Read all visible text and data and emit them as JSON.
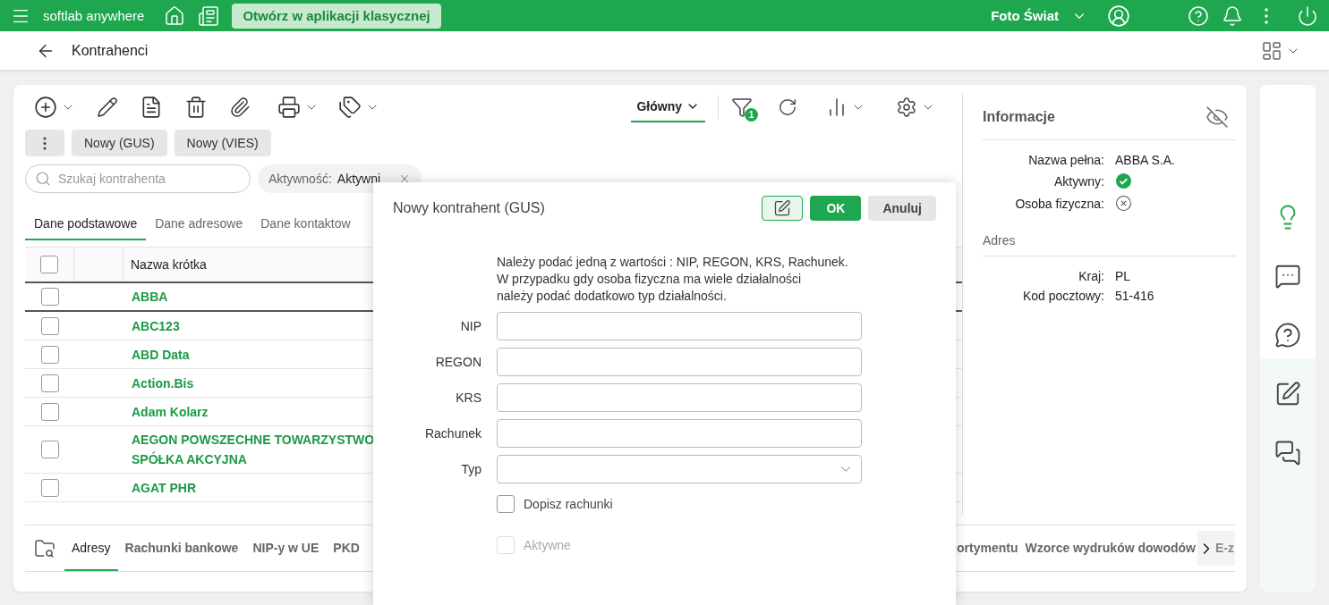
{
  "topbar": {
    "app_name": "softlab anywhere",
    "classic_button": "Otwórz w aplikacji klasycznej",
    "company": "Foto Świat"
  },
  "header": {
    "title": "Kontrahenci"
  },
  "toolbar": {
    "actions": [
      "Nowy (GUS)",
      "Nowy (VIES)"
    ],
    "view": "Główny",
    "filter_count": "1"
  },
  "search": {
    "placeholder": "Szukaj kontrahenta"
  },
  "filter_chip": {
    "label": "Aktywność:",
    "value": "Aktywni"
  },
  "tabs": [
    {
      "label": "Dane podstawowe",
      "selected": true
    },
    {
      "label": "Dane adresowe",
      "selected": false
    },
    {
      "label": "Dane kontaktow",
      "selected": false
    }
  ],
  "table": {
    "columns": [
      "Nazwa krótka"
    ],
    "all_checked": false,
    "rows": [
      {
        "name": "ABBA",
        "selected": true,
        "checked": false
      },
      {
        "name": "ABC123",
        "selected": false,
        "checked": false
      },
      {
        "name": "ABD Data",
        "selected": false,
        "checked": false
      },
      {
        "name": "Action.Bis",
        "selected": false,
        "checked": false
      },
      {
        "name": "Adam Kolarz",
        "selected": false,
        "checked": false
      },
      {
        "name": "AEGON POWSZECHNE TOWARZYSTWO SPÓŁKA AKCYJNA",
        "selected": false,
        "checked": false
      },
      {
        "name": "AGAT PHR",
        "selected": false,
        "checked": false
      }
    ]
  },
  "bottom_tabs": [
    {
      "label": "Adresy",
      "selected": true
    },
    {
      "label": "Rachunki bankowe",
      "selected": false
    },
    {
      "label": "NIP-y w UE",
      "selected": false
    },
    {
      "label": "PKD",
      "selected": false
    },
    {
      "label": "ortymentu",
      "selected": false
    },
    {
      "label": "Wzorce wydruków dowodów",
      "selected": false
    },
    {
      "label": "E-z",
      "selected": false
    }
  ],
  "info": {
    "title": "Informacje",
    "fields": [
      {
        "label": "Nazwa pełna:",
        "kind": "text",
        "value": "ABBA S.A."
      },
      {
        "label": "Aktywny:",
        "kind": "flag",
        "on": true
      },
      {
        "label": "Osoba fizyczna:",
        "kind": "flag",
        "on": false
      }
    ],
    "address": {
      "title": "Adres",
      "fields": [
        {
          "label": "Kraj:",
          "kind": "text",
          "value": "PL"
        },
        {
          "label": "Kod pocztowy:",
          "kind": "text",
          "value": "51-416"
        }
      ]
    }
  },
  "dialog": {
    "title": "Nowy kontrahent (GUS)",
    "ok": "OK",
    "cancel": "Anuluj",
    "note": "Należy podać jedną z wartości : NIP, REGON, KRS, Rachunek.\nW przypadku gdy osoba fizyczna ma wiele działalności\nnależy podać dodatkowo typ działalności.",
    "fields": [
      {
        "label": "NIP",
        "kind": "input"
      },
      {
        "label": "REGON",
        "kind": "input"
      },
      {
        "label": "KRS",
        "kind": "input"
      },
      {
        "label": "Rachunek",
        "kind": "input"
      },
      {
        "label": "Typ",
        "kind": "select"
      }
    ],
    "options": [
      {
        "label": "Dopisz rachunki",
        "checked": false,
        "disabled": false
      },
      {
        "label": "Aktywne",
        "checked": false,
        "disabled": true
      }
    ]
  }
}
